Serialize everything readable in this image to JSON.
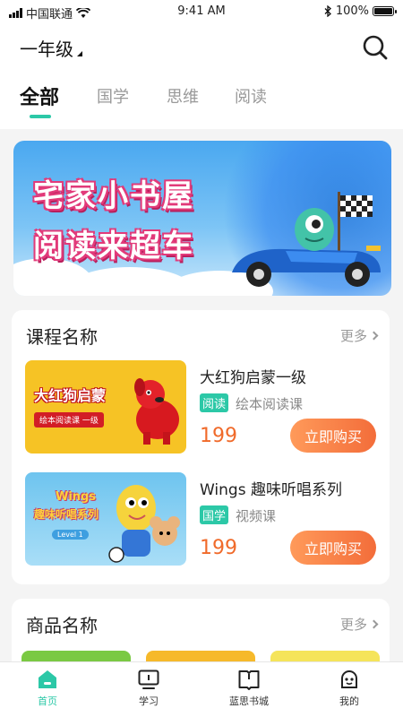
{
  "status_bar": {
    "carrier": "中国联通",
    "time": "9:41 AM",
    "battery": "100%"
  },
  "header": {
    "grade": "一年级"
  },
  "tabs": [
    {
      "label": "全部"
    },
    {
      "label": "国学"
    },
    {
      "label": "思维"
    },
    {
      "label": "阅读"
    }
  ],
  "banner": {
    "line1": "宅家小书屋",
    "line2": "阅读来超车",
    "slides": 3,
    "active_slide": 1
  },
  "course_section": {
    "title": "课程名称",
    "more": "更多",
    "items": [
      {
        "name": "大红狗启蒙一级",
        "tag": "阅读",
        "desc": "绘本阅读课",
        "price": "199",
        "buy": "立即购买",
        "thumb_title": "大红狗启蒙",
        "thumb_sub": "绘本阅读课 一级"
      },
      {
        "name": "Wings 趣味听唱系列",
        "tag": "国学",
        "desc": "视频课",
        "price": "199",
        "buy": "立即购买",
        "thumb_title": "Wings",
        "thumb_sub": "趣味听唱系列",
        "thumb_level": "Level 1"
      }
    ]
  },
  "goods_section": {
    "title": "商品名称",
    "more": "更多"
  },
  "tabbar": [
    {
      "label": "首页"
    },
    {
      "label": "学习"
    },
    {
      "label": "蓝思书城"
    },
    {
      "label": "我的"
    }
  ],
  "colors": {
    "accent": "#2cc8a7",
    "price": "#f06a2a",
    "buy_start": "#ff9a5a",
    "buy_end": "#f36d3a"
  }
}
